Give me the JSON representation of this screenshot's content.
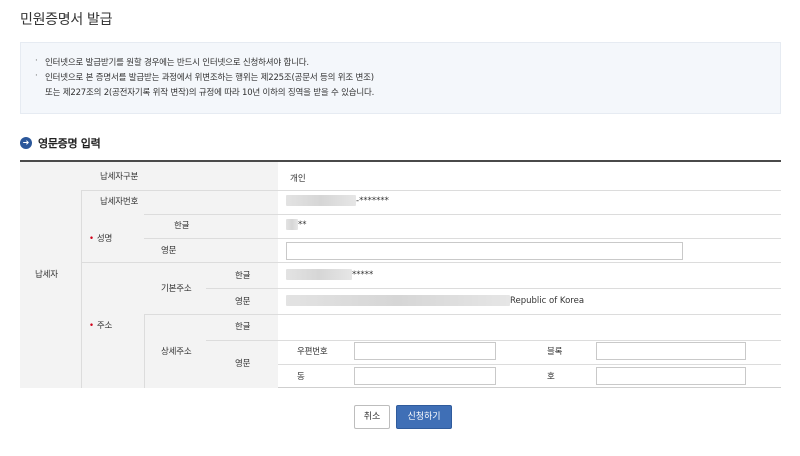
{
  "page": {
    "title": "민원증명서 발급"
  },
  "notice": {
    "line1": "인터넷으로 발급받기를 원할 경우에는 반드시 인터넷으로 신청하셔야 합니다.",
    "line2": "인터넷으로 본 증명서를 발급받는 과정에서 위변조하는 행위는 제225조(공문서 등의 위조 변조)",
    "line3": "또는 제227조의 2(공전자기록 위작 변작)의 규정에 따라 10년 이하의 징역을 받을 수 있습니다."
  },
  "section": {
    "title": "영문증명 입력"
  },
  "form": {
    "taxpayer_label": "납세자",
    "taxpayer_type_label": "납세자구분",
    "taxpayer_type_value": "개인",
    "taxpayer_number_label": "납세자번호",
    "taxpayer_number_masked": "-*******",
    "name_label": "성명",
    "korean_label": "한글",
    "name_korean_masked": "**",
    "english_label": "영문",
    "name_english_value": "",
    "address_label": "주소",
    "basic_address_label": "기본주소",
    "basic_korean_masked": "*****",
    "basic_english_suffix": "Republic of Korea",
    "detail_address_label": "상세주소",
    "postal_code_label": "우편번호",
    "block_label": "블록",
    "dong_label": "동",
    "ho_label": "호"
  },
  "buttons": {
    "cancel": "취소",
    "apply": "신청하기"
  }
}
